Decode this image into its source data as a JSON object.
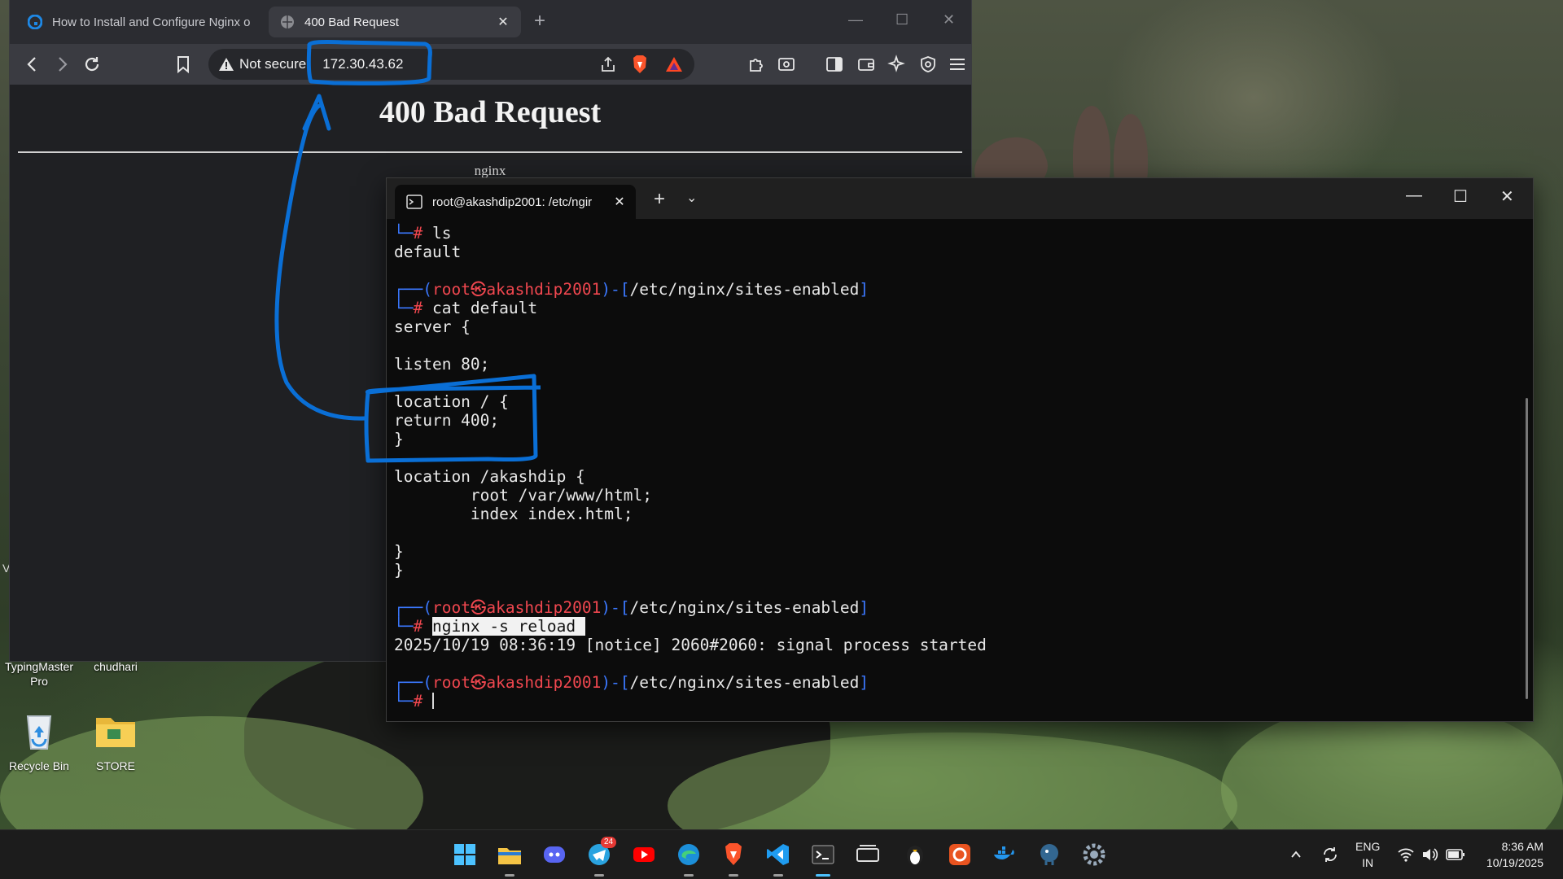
{
  "desktop": {
    "icons": [
      {
        "label": "TypingMaster\nPro",
        "name": "typingmaster"
      },
      {
        "label": "chudhari",
        "name": "chudhari"
      },
      {
        "label": "Recycle Bin",
        "name": "recycle-bin"
      },
      {
        "label": "STORE",
        "name": "store-folder"
      }
    ],
    "edge_label": "V"
  },
  "browser": {
    "tabs": [
      {
        "title": "How to Install and Configure Nginx o",
        "state": "inactive"
      },
      {
        "title": "400 Bad Request",
        "state": "active"
      }
    ],
    "new_tab": "+",
    "address": {
      "security": "Not secure",
      "url": "172.30.43.62"
    },
    "page": {
      "heading": "400 Bad Request",
      "server": "nginx"
    },
    "icons": [
      "back-icon",
      "forward-icon",
      "reload-icon",
      "bookmark-icon",
      "share-icon",
      "brave-shield-icon",
      "bat-rewards-icon",
      "extensions-icon",
      "reader-icon",
      "sidebar-icon",
      "wallet-icon",
      "leo-icon",
      "vpn-icon",
      "menu-icon"
    ]
  },
  "terminal": {
    "tab_title": "root@akashdip2001: /etc/ngir",
    "new_tab": "+",
    "lines": [
      {
        "segments": [
          {
            "t": "└─",
            "c": "blue"
          },
          {
            "t": "# ",
            "c": "red"
          },
          {
            "t": "ls",
            "c": "white"
          }
        ]
      },
      {
        "segments": [
          {
            "t": "default",
            "c": "white"
          }
        ]
      },
      {
        "segments": [
          {
            "t": "",
            "c": "white"
          }
        ]
      },
      {
        "segments": [
          {
            "t": "┌──(",
            "c": "blue"
          },
          {
            "t": "root㉿akashdip2001",
            "c": "red"
          },
          {
            "t": ")-[",
            "c": "blue"
          },
          {
            "t": "/etc/nginx/sites-enabled",
            "c": "white"
          },
          {
            "t": "]",
            "c": "blue"
          }
        ]
      },
      {
        "segments": [
          {
            "t": "└─",
            "c": "blue"
          },
          {
            "t": "# ",
            "c": "red"
          },
          {
            "t": "cat default",
            "c": "white"
          }
        ]
      },
      {
        "segments": [
          {
            "t": "server {",
            "c": "white"
          }
        ]
      },
      {
        "segments": [
          {
            "t": "",
            "c": "white"
          }
        ]
      },
      {
        "segments": [
          {
            "t": "listen 80;",
            "c": "white"
          }
        ]
      },
      {
        "segments": [
          {
            "t": "",
            "c": "white"
          }
        ]
      },
      {
        "segments": [
          {
            "t": "location / {",
            "c": "white"
          }
        ]
      },
      {
        "segments": [
          {
            "t": "return 400;",
            "c": "white"
          }
        ]
      },
      {
        "segments": [
          {
            "t": "}",
            "c": "white"
          }
        ]
      },
      {
        "segments": [
          {
            "t": "",
            "c": "white"
          }
        ]
      },
      {
        "segments": [
          {
            "t": "location /akashdip {",
            "c": "white"
          }
        ]
      },
      {
        "segments": [
          {
            "t": "        root /var/www/html;",
            "c": "white"
          }
        ]
      },
      {
        "segments": [
          {
            "t": "        index index.html;",
            "c": "white"
          }
        ]
      },
      {
        "segments": [
          {
            "t": "",
            "c": "white"
          }
        ]
      },
      {
        "segments": [
          {
            "t": "}",
            "c": "white"
          }
        ]
      },
      {
        "segments": [
          {
            "t": "}",
            "c": "white"
          }
        ]
      },
      {
        "segments": [
          {
            "t": "",
            "c": "white"
          }
        ]
      },
      {
        "segments": [
          {
            "t": "┌──(",
            "c": "blue"
          },
          {
            "t": "root㉿akashdip2001",
            "c": "red"
          },
          {
            "t": ")-[",
            "c": "blue"
          },
          {
            "t": "/etc/nginx/sites-enabled",
            "c": "white"
          },
          {
            "t": "]",
            "c": "blue"
          }
        ]
      },
      {
        "segments": [
          {
            "t": "└─",
            "c": "blue"
          },
          {
            "t": "# ",
            "c": "red"
          },
          {
            "t": "nginx -s reload ",
            "c": "hl"
          }
        ]
      },
      {
        "segments": [
          {
            "t": "2025/10/19 08:36:19 [notice] 2060#2060: signal process started",
            "c": "white"
          }
        ]
      },
      {
        "segments": [
          {
            "t": "",
            "c": "white"
          }
        ]
      },
      {
        "segments": [
          {
            "t": "┌──(",
            "c": "blue"
          },
          {
            "t": "root㉿akashdip2001",
            "c": "red"
          },
          {
            "t": ")-[",
            "c": "blue"
          },
          {
            "t": "/etc/nginx/sites-enabled",
            "c": "white"
          },
          {
            "t": "]",
            "c": "blue"
          }
        ]
      },
      {
        "segments": [
          {
            "t": "└─",
            "c": "blue"
          },
          {
            "t": "# ",
            "c": "red"
          },
          {
            "t": "CURSOR",
            "c": "cursor"
          }
        ]
      }
    ]
  },
  "taskbar": {
    "apps": [
      "start-icon",
      "file-explorer-icon",
      "discord-icon",
      "telegram-icon",
      "youtube-icon",
      "edge-icon",
      "brave-icon",
      "vscode-icon",
      "terminal-icon",
      "wsl-icon",
      "linux-penguin-icon",
      "ubuntu-icon",
      "docker-icon",
      "postgresql-icon",
      "settings-icon"
    ],
    "telegram_badge": "24",
    "lang_top": "ENG",
    "lang_bottom": "IN",
    "time": "8:36 AM",
    "date": "10/19/2025"
  },
  "colors": {
    "annotation": "#0a6fd6",
    "prompt_blue": "#3b78ff",
    "prompt_red": "#f0474f"
  }
}
